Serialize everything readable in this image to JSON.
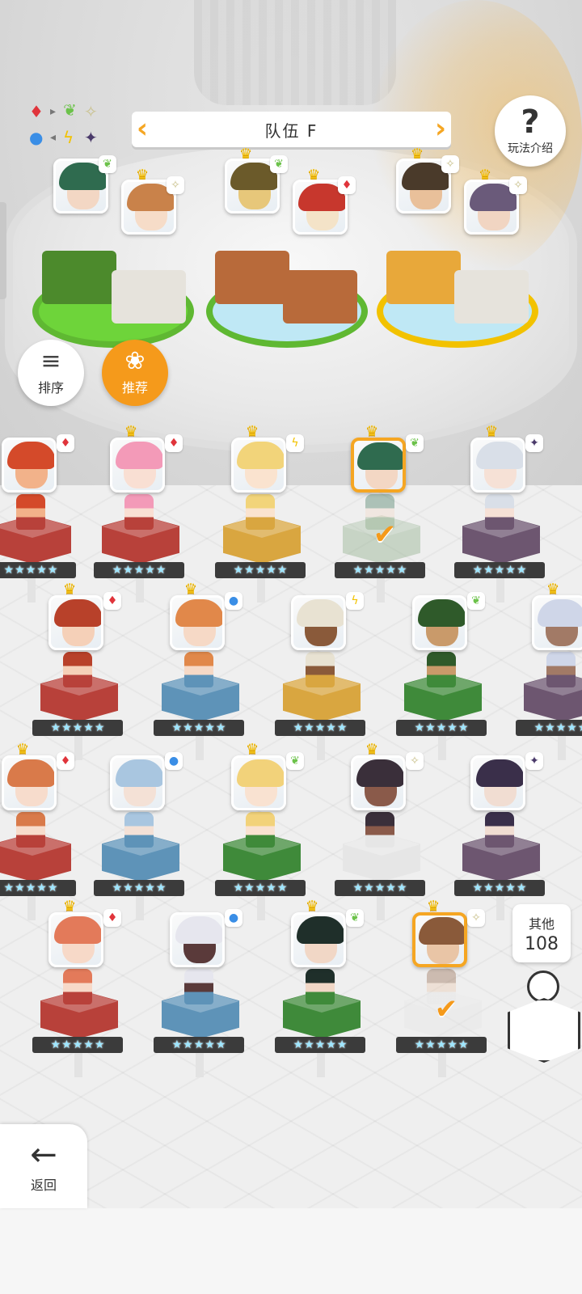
{
  "header": {
    "team_title": "队伍 F",
    "prev_arrow": "‹",
    "next_arrow": "›"
  },
  "help": {
    "label": "玩法介绍",
    "icon": "question-mark-icon"
  },
  "element_legend": {
    "icons": [
      "fire-diamond-icon",
      "leaf-icon",
      "sparkle-icon",
      "water-dot-icon",
      "lightning-icon",
      "dark-star-icon"
    ],
    "glyphs": [
      "♦",
      "➝",
      "✦",
      "●",
      "ϟ",
      "✦"
    ]
  },
  "controls": {
    "sort_label": "排序",
    "sort_icon": "≡",
    "recommend_label": "推荐",
    "recommend_icon": "❀"
  },
  "others": {
    "label": "其他",
    "count": "108"
  },
  "back": {
    "label": "返回",
    "icon": "←"
  },
  "element_glyphs": {
    "fire": "♦",
    "leaf": "❦",
    "light": "✧",
    "water": "●",
    "thunder": "ϟ",
    "dark": "✦"
  },
  "element_colors": {
    "fire": "#e0343b",
    "leaf": "#6cc24a",
    "light": "#c9c08a",
    "water": "#3a8ee6",
    "thunder": "#f2c200",
    "dark": "#4a3a6a"
  },
  "stars_per_hero": 5,
  "team_slots": [
    {
      "element": "leaf",
      "crowned": false,
      "hair": "#2f6b4f",
      "face": "#f3d7c4"
    },
    {
      "element": "light",
      "crowned": true,
      "hair": "#c9824a",
      "face": "#f6dcc8"
    },
    {
      "element": "leaf",
      "crowned": true,
      "hair": "#6b5a2a",
      "face": "#e7c77a"
    },
    {
      "element": "fire",
      "crowned": true,
      "hair": "#c7372d",
      "face": "#f4e3c8"
    },
    {
      "element": "light",
      "crowned": true,
      "hair": "#4a3a2a",
      "face": "#e9c09a"
    },
    {
      "element": "light",
      "crowned": true,
      "hair": "#6a5a7a",
      "face": "#f1d5c2"
    }
  ],
  "roster": [
    {
      "element": "fire",
      "pedestal": "#b8413a",
      "hair": "#d44a2a",
      "face": "#f2b28a",
      "crowned": false,
      "selected": false
    },
    {
      "element": "fire",
      "pedestal": "#b8413a",
      "hair": "#f39ab8",
      "face": "#f9dfd3",
      "crowned": true,
      "selected": false
    },
    {
      "element": "thunder",
      "pedestal": "#d9a640",
      "hair": "#f2d47a",
      "face": "#fae3cf",
      "crowned": true,
      "selected": false
    },
    {
      "element": "leaf",
      "pedestal": "#7fa37a",
      "hair": "#2f6b4f",
      "face": "#f3d7c4",
      "crowned": true,
      "selected": true
    },
    {
      "element": "dark",
      "pedestal": "#6d5670",
      "hair": "#d9dfe8",
      "face": "#f6e1d6",
      "crowned": true,
      "selected": false
    },
    {
      "element": "fire",
      "pedestal": "#b8413a",
      "hair": "#b8412a",
      "face": "#f5d0b8",
      "crowned": true,
      "selected": false
    },
    {
      "element": "water",
      "pedestal": "#5e93b8",
      "hair": "#e1884a",
      "face": "#f6d9c6",
      "crowned": true,
      "selected": false
    },
    {
      "element": "thunder",
      "pedestal": "#d9a640",
      "hair": "#e8e2d2",
      "face": "#8a5a3a",
      "crowned": false,
      "selected": false
    },
    {
      "element": "leaf",
      "pedestal": "#3f8a3a",
      "hair": "#2f5a2a",
      "face": "#c99a6a",
      "crowned": false,
      "selected": false
    },
    {
      "element": "dark",
      "pedestal": "#6d5670",
      "hair": "#cfd6e8",
      "face": "#a27a66",
      "crowned": true,
      "selected": false
    },
    {
      "element": "fire",
      "pedestal": "#b8413a",
      "hair": "#d97a4a",
      "face": "#f7dccc",
      "crowned": true,
      "selected": false
    },
    {
      "element": "water",
      "pedestal": "#5e93b8",
      "hair": "#a9c6e0",
      "face": "#f4e1d6",
      "crowned": false,
      "selected": false
    },
    {
      "element": "leaf",
      "pedestal": "#3f8a3a",
      "hair": "#f2d27a",
      "face": "#f9e2d1",
      "crowned": true,
      "selected": false
    },
    {
      "element": "light",
      "pedestal": "#e6e6e6",
      "hair": "#3a2f3a",
      "face": "#8a5a4a",
      "crowned": true,
      "selected": false
    },
    {
      "element": "dark",
      "pedestal": "#6d5670",
      "hair": "#3a2f4a",
      "face": "#f1ddd2",
      "crowned": false,
      "selected": false
    },
    {
      "element": "fire",
      "pedestal": "#b8413a",
      "hair": "#e37a5a",
      "face": "#f7d9c8",
      "crowned": true,
      "selected": false
    },
    {
      "element": "water",
      "pedestal": "#5e93b8",
      "hair": "#e6e6ee",
      "face": "#5a3a3a",
      "crowned": false,
      "selected": false
    },
    {
      "element": "leaf",
      "pedestal": "#3f8a3a",
      "hair": "#1f2f2a",
      "face": "#f1d7c6",
      "crowned": true,
      "selected": false
    },
    {
      "element": "light",
      "pedestal": "#e6e6e6",
      "hair": "#8a5a3a",
      "face": "#e9c5a6",
      "crowned": true,
      "selected": true
    }
  ]
}
